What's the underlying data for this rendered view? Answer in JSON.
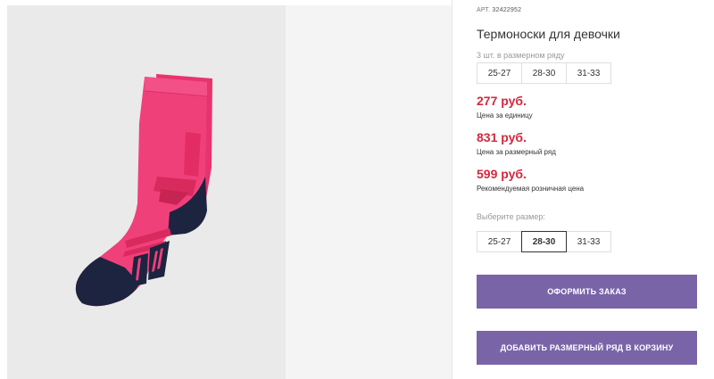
{
  "product": {
    "art_label": "АРТ",
    "art_number": "32422952",
    "title": "Термоноски для девочки",
    "pack_note": "3 шт. в размерном ряду",
    "size_range": [
      "25-27",
      "28-30",
      "31-33"
    ],
    "prices": [
      {
        "value": "277 руб.",
        "caption": "Цена за единицу"
      },
      {
        "value": "831 руб.",
        "caption": "Цена за размерный ряд"
      },
      {
        "value": "599 руб.",
        "caption": "Рекомендуемая розничная цена"
      }
    ],
    "choose_size_label": "Выберите размер:",
    "size_options": [
      "25-27",
      "28-30",
      "31-33"
    ],
    "selected_size": "28-30"
  },
  "actions": {
    "order_label": "ОФОРМИТЬ ЗАКАЗ",
    "add_row_label": "ДОБАВИТЬ РАЗМЕРНЫЙ РЯД В КОРЗИНУ"
  },
  "colors": {
    "price": "#d4283f",
    "button": "#7a64a8",
    "sock_main": "#f0407a",
    "sock_dark": "#1d2440"
  }
}
